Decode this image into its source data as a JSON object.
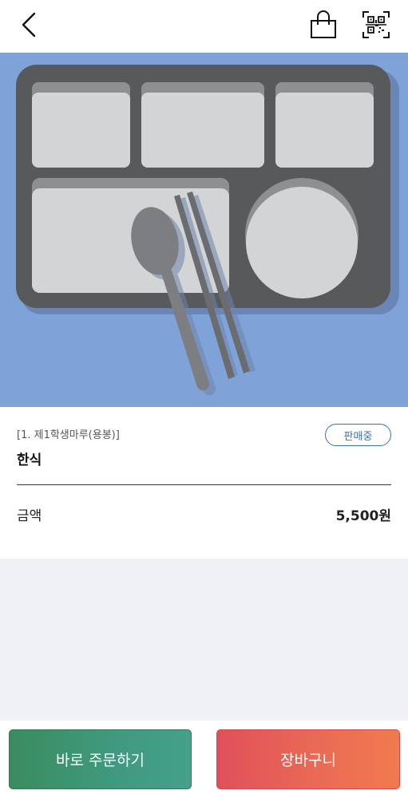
{
  "header": {
    "back_icon": "chevron-left-icon",
    "bag_icon": "shopping-bag-icon",
    "qr_icon": "qr-scan-icon"
  },
  "hero": {
    "image": "meal-tray-illustration",
    "background_color": "#7fa3d8"
  },
  "product": {
    "store": "[1. 제1학생마루(용봉)]",
    "status": "판매중",
    "name": "한식",
    "price_label": "금액",
    "price": "5,500원"
  },
  "actions": {
    "order_now": "바로 주문하기",
    "cart": "장바구니"
  },
  "colors": {
    "status_accent": "#3b6fc4",
    "order_button": "#3f9a80",
    "cart_button": "#ea6a55"
  }
}
